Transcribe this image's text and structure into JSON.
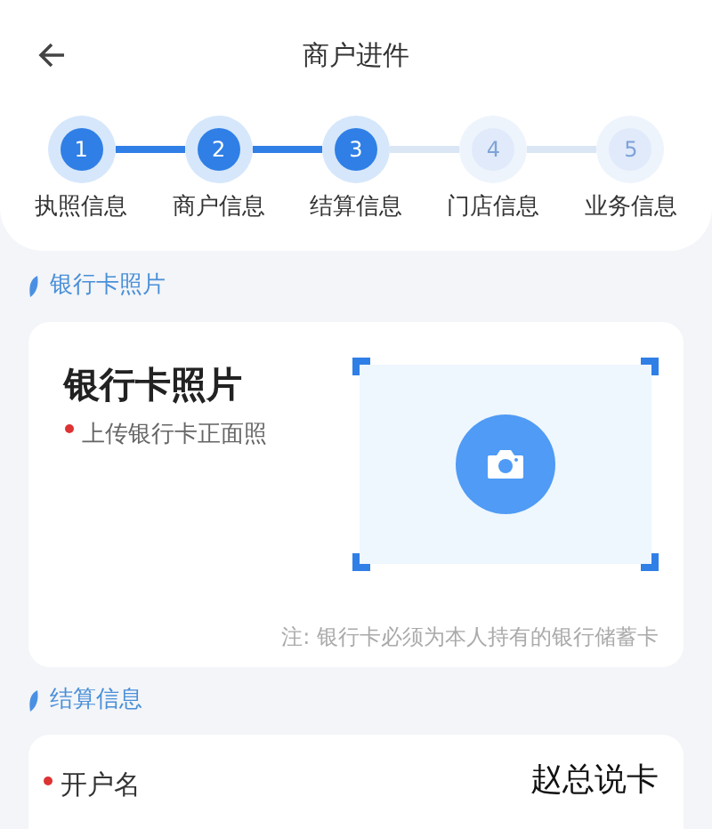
{
  "header": {
    "title": "商户进件"
  },
  "steps": [
    {
      "number": "1",
      "label": "执照信息",
      "done": true
    },
    {
      "number": "2",
      "label": "商户信息",
      "done": true
    },
    {
      "number": "3",
      "label": "结算信息",
      "done": true
    },
    {
      "number": "4",
      "label": "门店信息",
      "done": false
    },
    {
      "number": "5",
      "label": "业务信息",
      "done": false
    }
  ],
  "bank_card_section": {
    "title": "银行卡照片",
    "card_title": "银行卡照片",
    "hint": "上传银行卡正面照",
    "hint_required": true,
    "note": "注: 银行卡必须为本人持有的银行储蓄卡"
  },
  "settlement_section": {
    "title": "结算信息",
    "fields": [
      {
        "label": "开户名",
        "value": "赵总说卡",
        "required": true
      }
    ]
  }
}
